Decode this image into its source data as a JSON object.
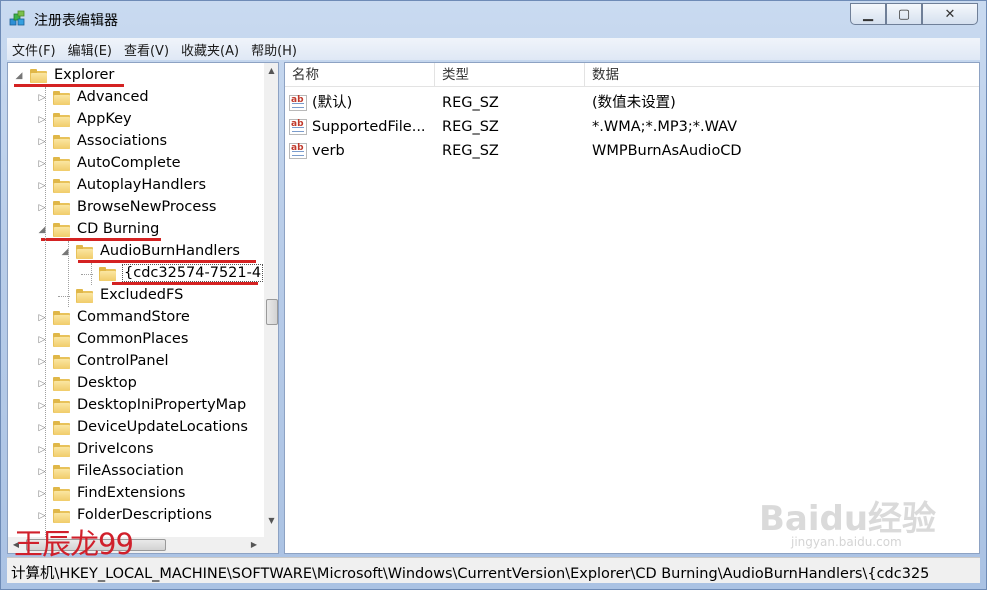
{
  "window": {
    "title": "注册表编辑器",
    "app_icon": "regedit-icon"
  },
  "window_buttons": {
    "minimize": "▁",
    "maximize": "▢",
    "close": "✕"
  },
  "menu": [
    "文件(F)",
    "编辑(E)",
    "查看(V)",
    "收藏夹(A)",
    "帮助(H)"
  ],
  "tree": [
    {
      "label": "Explorer",
      "expanded": true,
      "highlighted": true
    },
    {
      "label": "Advanced"
    },
    {
      "label": "AppKey"
    },
    {
      "label": "Associations"
    },
    {
      "label": "AutoComplete"
    },
    {
      "label": "AutoplayHandlers"
    },
    {
      "label": "BrowseNewProcess"
    },
    {
      "label": "CD Burning",
      "expanded": true,
      "highlighted": true
    },
    {
      "label": "AudioBurnHandlers",
      "expanded": true,
      "highlighted": true
    },
    {
      "label": "{cdc32574-7521-4",
      "highlighted": true,
      "selected": true
    },
    {
      "label": "ExcludedFS"
    },
    {
      "label": "CommandStore"
    },
    {
      "label": "CommonPlaces"
    },
    {
      "label": "ControlPanel"
    },
    {
      "label": "Desktop"
    },
    {
      "label": "DesktopIniPropertyMap"
    },
    {
      "label": "DeviceUpdateLocations"
    },
    {
      "label": "DriveIcons"
    },
    {
      "label": "FileAssociation"
    },
    {
      "label": "FindExtensions"
    },
    {
      "label": "FolderDescriptions"
    }
  ],
  "list": {
    "columns": [
      "名称",
      "类型",
      "数据"
    ],
    "rows": [
      {
        "name": "(默认)",
        "type": "REG_SZ",
        "data": "(数值未设置)",
        "icon": "string-value-icon"
      },
      {
        "name": "SupportedFile...",
        "type": "REG_SZ",
        "data": "*.WMA;*.MP3;*.WAV",
        "icon": "string-value-icon"
      },
      {
        "name": "verb",
        "type": "REG_SZ",
        "data": "WMPBurnAsAudioCD",
        "icon": "string-value-icon"
      }
    ]
  },
  "status": {
    "path": "计算机\\HKEY_LOCAL_MACHINE\\SOFTWARE\\Microsoft\\Windows\\CurrentVersion\\Explorer\\CD Burning\\AudioBurnHandlers\\{cdc325"
  },
  "author_mark": "王辰龙99",
  "watermark": {
    "logo": "Baidu经验",
    "sub": "jingyan.baidu.com"
  },
  "colors": {
    "annotation_red": "#d42222",
    "folder_yellow": "#f1cc6a",
    "title_gradient": "#b9cde9"
  }
}
